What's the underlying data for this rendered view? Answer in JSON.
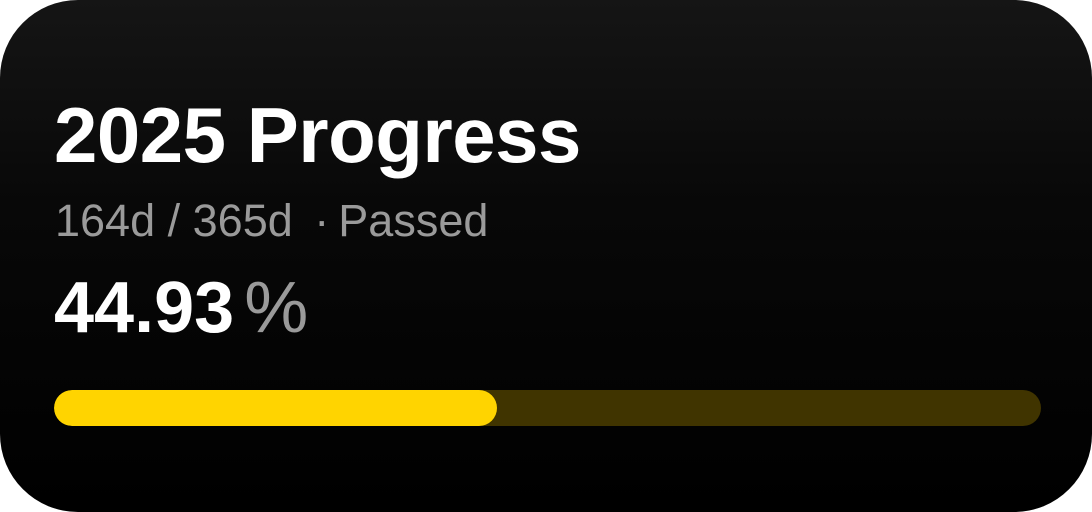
{
  "widget": {
    "title": "2025 Progress",
    "days_passed": "164d",
    "separator_slash": "/",
    "days_total": "365d",
    "separator_dot": "·",
    "status": "Passed",
    "percent_value": "44.93",
    "percent_unit": "%",
    "progress_fraction": 0.4493
  },
  "colors": {
    "accent": "#FFD400",
    "track": "#403400",
    "muted_text": "#9A9A9A"
  }
}
